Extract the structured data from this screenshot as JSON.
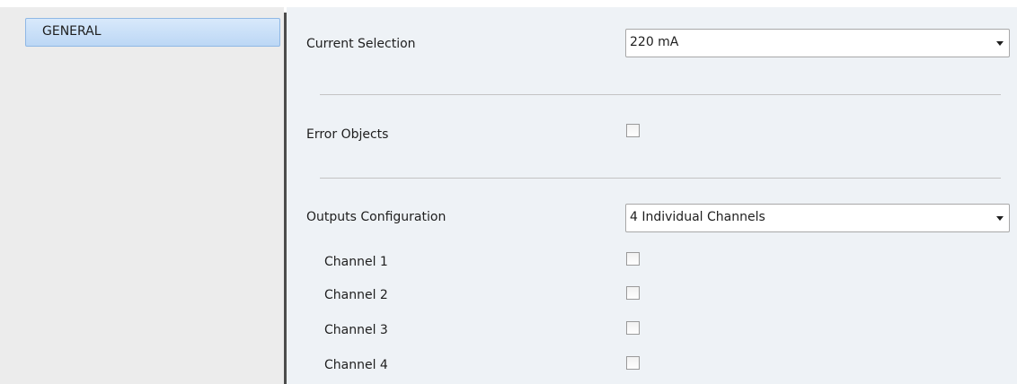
{
  "sidebar": {
    "items": [
      {
        "label": "GENERAL",
        "selected": true
      }
    ]
  },
  "main": {
    "current_selection": {
      "label": "Current Selection",
      "value": "220 mA"
    },
    "error_objects": {
      "label": "Error Objects",
      "checked": false
    },
    "outputs_configuration": {
      "label": "Outputs Configuration",
      "value": "4 Individual Channels"
    },
    "channels": [
      {
        "label": "Channel 1",
        "checked": false
      },
      {
        "label": "Channel 2",
        "checked": false
      },
      {
        "label": "Channel 3",
        "checked": false
      },
      {
        "label": "Channel 4",
        "checked": false
      }
    ]
  },
  "colors": {
    "panel_background": "#eef2f6",
    "sidebar_background": "#ececec",
    "selected_item_top": "#d8e9fb",
    "selected_item_bottom": "#bcd7f5",
    "selected_item_border": "#8fb8e5",
    "divider": "#4c4c4c"
  },
  "icons": {
    "dropdown": "chevron-down-icon"
  }
}
